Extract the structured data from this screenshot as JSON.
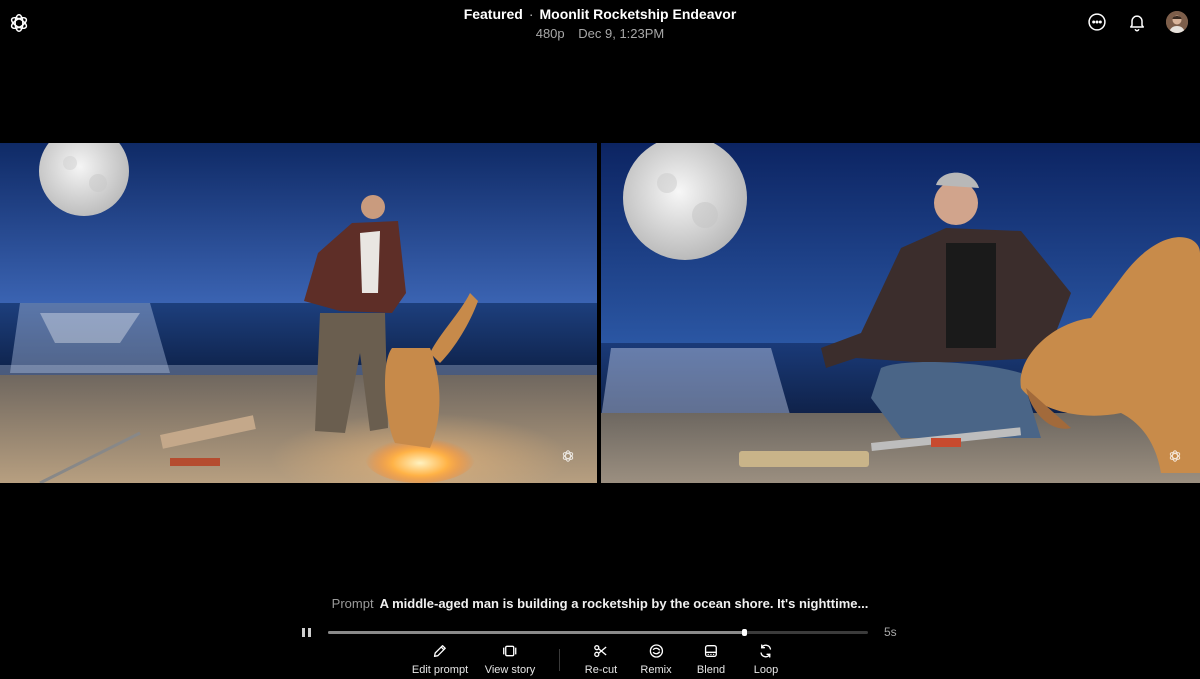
{
  "header": {
    "section": "Featured",
    "separator": "·",
    "title": "Moonlit Rocketship Endeavor",
    "resolution": "480p",
    "timestamp": "Dec 9, 1:23PM"
  },
  "icons": {
    "logo": "openai-logo-icon",
    "more": "more-options-icon",
    "notifications": "bell-icon",
    "avatar": "user-avatar",
    "watermark": "openai-watermark-icon"
  },
  "prompt": {
    "label": "Prompt",
    "text": "A middle-aged man is building a rocketship by the ocean shore. It's nighttime..."
  },
  "player": {
    "state": "playing",
    "progress": 0.77,
    "duration": "5s"
  },
  "toolbar": {
    "edit_prompt": "Edit prompt",
    "view_story": "View story",
    "recut": "Re-cut",
    "remix": "Remix",
    "blend": "Blend",
    "loop": "Loop"
  },
  "colors": {
    "background": "#000000",
    "sky": "#1c3a78",
    "sand": "#9b8770",
    "fire": "#ffb347"
  }
}
